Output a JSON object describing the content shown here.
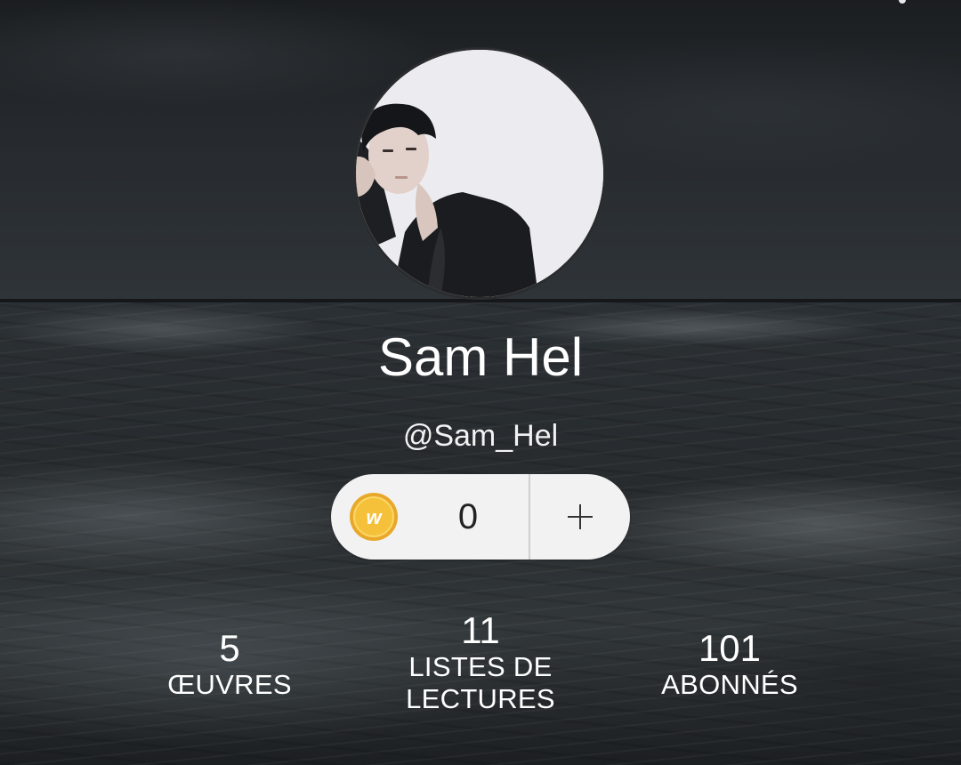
{
  "profile": {
    "display_name": "Sam Hel",
    "username": "@Sam_Hel",
    "avatar_alt": "profile photo"
  },
  "coins": {
    "icon": "wattpad-coin-icon",
    "icon_letter": "w",
    "value": "0",
    "add_icon": "plus-icon",
    "accent": "#f5c13a"
  },
  "stats": {
    "works": {
      "value": "5",
      "label": "ŒUVRES"
    },
    "reading_lists": {
      "value": "11",
      "label_line1": "LISTES DE",
      "label_line2": "LECTURES"
    },
    "followers": {
      "value": "101",
      "label": "ABONNÉS"
    }
  },
  "colors": {
    "pill_bg": "#f2f2f2",
    "text": "#ffffff",
    "coin": "#f5c13a"
  }
}
